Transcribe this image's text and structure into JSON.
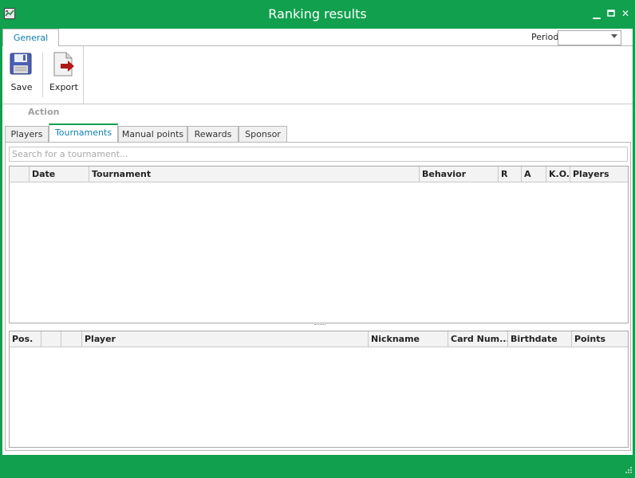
{
  "window": {
    "title": "Ranking results"
  },
  "ribbon": {
    "tab_label": "General",
    "period_label": "Period",
    "period_value": "",
    "save_label": "Save",
    "export_label": "Export",
    "group_caption": "Action"
  },
  "tabs": [
    "Players",
    "Tournaments",
    "Manual points",
    "Rewards",
    "Sponsor"
  ],
  "active_tab": "Tournaments",
  "search": {
    "placeholder": "Search for a tournament..."
  },
  "tournament_grid": {
    "columns": [
      "",
      "Date",
      "Tournament",
      "Behavior",
      "R",
      "A",
      "K.O.",
      "Players"
    ],
    "rows": []
  },
  "player_grid": {
    "columns": [
      "Pos.",
      "",
      "",
      "Player",
      "Nickname",
      "Card Num...",
      "Birthdate",
      "Points"
    ],
    "rows": []
  },
  "colors": {
    "accent": "#11a04e",
    "tab_text": "#0d7fb0"
  },
  "icons": {
    "app": "app-icon",
    "save": "floppy-disk-icon",
    "export": "export-document-icon",
    "minimize": "minimize-icon",
    "maximize": "maximize-icon",
    "close": "close-icon"
  }
}
